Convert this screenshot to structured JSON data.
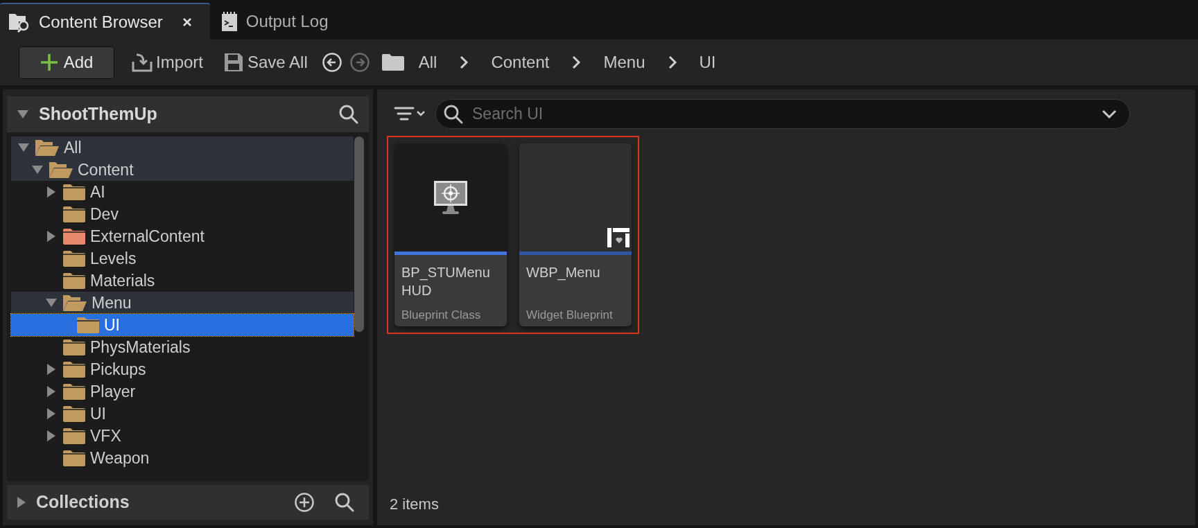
{
  "tabs": [
    {
      "label": "Content Browser",
      "selected": true,
      "closable": true
    },
    {
      "label": "Output Log",
      "selected": false,
      "closable": false
    }
  ],
  "toolbar": {
    "add_button": "Add",
    "import_button": "Import",
    "save_all_button": "Save All",
    "nav": [
      {
        "kind": "back",
        "disabled": false
      },
      {
        "kind": "forward",
        "disabled": true
      }
    ],
    "breadcrumbs": [
      "All",
      "Content",
      "Menu",
      "UI"
    ]
  },
  "sources": {
    "title": "ShootThemUp",
    "expanded": true,
    "tree": [
      {
        "label": "All",
        "expandable": true,
        "expanded": true,
        "selected": false,
        "highlighted": true,
        "color": "#c09a5e",
        "children": [
          {
            "label": "Content",
            "expandable": true,
            "expanded": true,
            "selected": false,
            "highlighted": true,
            "color": "#c09a5e",
            "children": [
              {
                "label": "AI",
                "expandable": true,
                "expanded": false,
                "selected": false,
                "highlighted": false,
                "color": "#c09a5e"
              },
              {
                "label": "Dev",
                "expandable": false,
                "expanded": false,
                "selected": false,
                "highlighted": false,
                "color": "#c09a5e"
              },
              {
                "label": "ExternalContent",
                "expandable": true,
                "expanded": false,
                "selected": false,
                "highlighted": false,
                "color": "#e8896a"
              },
              {
                "label": "Levels",
                "expandable": false,
                "expanded": false,
                "selected": false,
                "highlighted": false,
                "color": "#c09a5e"
              },
              {
                "label": "Materials",
                "expandable": false,
                "expanded": false,
                "selected": false,
                "highlighted": false,
                "color": "#c09a5e"
              },
              {
                "label": "Menu",
                "expandable": true,
                "expanded": true,
                "selected": false,
                "highlighted": true,
                "color": "#c09a5e",
                "children": [
                  {
                    "label": "UI",
                    "expandable": false,
                    "expanded": false,
                    "selected": true,
                    "highlighted": false,
                    "color": "#c09a5e"
                  }
                ]
              },
              {
                "label": "PhysMaterials",
                "expandable": false,
                "expanded": false,
                "selected": false,
                "highlighted": false,
                "color": "#c09a5e"
              },
              {
                "label": "Pickups",
                "expandable": true,
                "expanded": false,
                "selected": false,
                "highlighted": false,
                "color": "#c09a5e"
              },
              {
                "label": "Player",
                "expandable": true,
                "expanded": false,
                "selected": false,
                "highlighted": false,
                "color": "#c09a5e"
              },
              {
                "label": "UI",
                "expandable": true,
                "expanded": false,
                "selected": false,
                "highlighted": false,
                "color": "#c09a5e"
              },
              {
                "label": "VFX",
                "expandable": true,
                "expanded": false,
                "selected": false,
                "highlighted": false,
                "color": "#c09a5e"
              },
              {
                "label": "Weapon",
                "expandable": false,
                "expanded": false,
                "selected": false,
                "highlighted": false,
                "color": "#c09a5e"
              }
            ]
          }
        ]
      }
    ]
  },
  "collections": {
    "title": "Collections",
    "expanded": false
  },
  "search": {
    "placeholder": "Search UI"
  },
  "assets": {
    "outlined": true,
    "items": [
      {
        "name": "BP_STUMenu HUD",
        "type": "Blueprint Class",
        "kind": "hud",
        "color": "#3f74de"
      },
      {
        "name": "WBP_Menu",
        "type": "Widget Blueprint",
        "kind": "widget",
        "color": "#2f56a6"
      }
    ]
  },
  "item_count": "2 items"
}
